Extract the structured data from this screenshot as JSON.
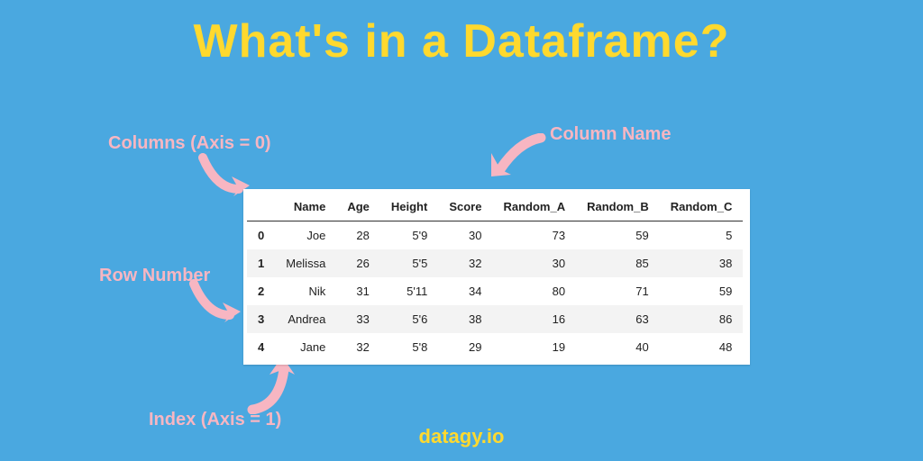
{
  "title": "What's in a Dataframe?",
  "footer": "datagy.io",
  "annotations": {
    "columns": "Columns (Axis = 0)",
    "column_name": "Column Name",
    "row_number": "Row Number",
    "index_axis": "Index (Axis = 1)"
  },
  "colors": {
    "background": "#4aa8e0",
    "title": "#ffd92e",
    "annotation": "#f7b6c2",
    "arrow": "#f7b6c2"
  },
  "chart_data": {
    "type": "table",
    "columns": [
      "Name",
      "Age",
      "Height",
      "Score",
      "Random_A",
      "Random_B",
      "Random_C"
    ],
    "index": [
      "0",
      "1",
      "2",
      "3",
      "4"
    ],
    "rows": [
      {
        "Name": "Joe",
        "Age": "28",
        "Height": "5'9",
        "Score": "30",
        "Random_A": "73",
        "Random_B": "59",
        "Random_C": "5"
      },
      {
        "Name": "Melissa",
        "Age": "26",
        "Height": "5'5",
        "Score": "32",
        "Random_A": "30",
        "Random_B": "85",
        "Random_C": "38"
      },
      {
        "Name": "Nik",
        "Age": "31",
        "Height": "5'11",
        "Score": "34",
        "Random_A": "80",
        "Random_B": "71",
        "Random_C": "59"
      },
      {
        "Name": "Andrea",
        "Age": "33",
        "Height": "5'6",
        "Score": "38",
        "Random_A": "16",
        "Random_B": "63",
        "Random_C": "86"
      },
      {
        "Name": "Jane",
        "Age": "32",
        "Height": "5'8",
        "Score": "29",
        "Random_A": "19",
        "Random_B": "40",
        "Random_C": "48"
      }
    ]
  }
}
